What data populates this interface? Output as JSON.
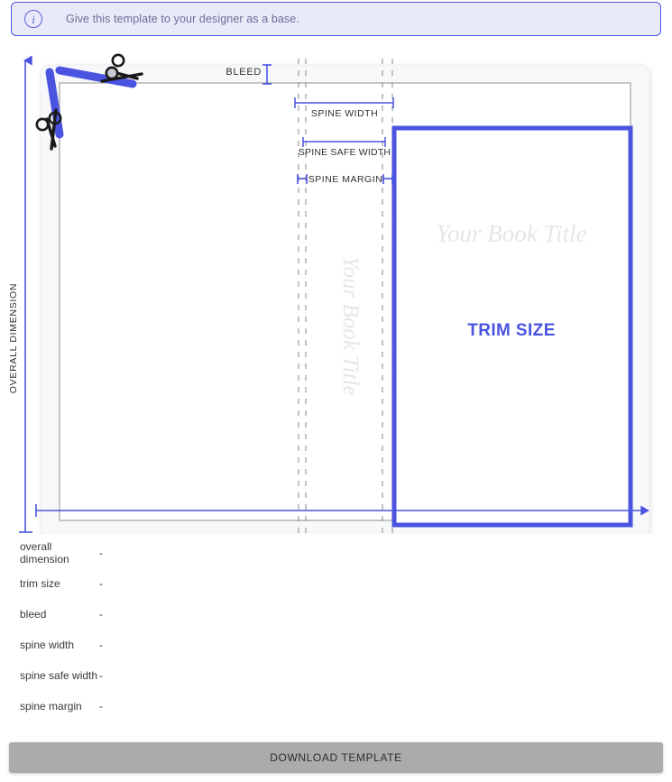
{
  "banner": {
    "icon": "info-circle-icon",
    "message": "Give this template to your designer as a base."
  },
  "diagram": {
    "overall_dimension_label": "OVERALL DIMENSION",
    "bleed_label": "BLEED",
    "spine_width_label": "SPINE WIDTH",
    "spine_safe_width_label": "SPINE SAFE WIDTH",
    "spine_margin_label": "SPINE MARGIN",
    "trim_size_label": "TRIM SIZE",
    "cover_title_placeholder": "Your Book Title",
    "spine_title_placeholder": "Your Book Title",
    "scissors_icon_top": "scissors-icon",
    "scissors_icon_left": "scissors-icon",
    "colors": {
      "accent": "#4a54e1",
      "trim_border": "#4a54e1",
      "guide_dash": "#9a9a9a",
      "placeholder_text": "#e6e6ea",
      "card_bg": "#f7f8fa"
    }
  },
  "specs": [
    {
      "label": "overall dimension",
      "value": "-"
    },
    {
      "label": "trim size",
      "value": "-"
    },
    {
      "label": "bleed",
      "value": "-"
    },
    {
      "label": "spine width",
      "value": "-"
    },
    {
      "label": "spine safe width",
      "value": "-"
    },
    {
      "label": "spine margin",
      "value": "-"
    }
  ],
  "download": {
    "label": "DOWNLOAD TEMPLATE"
  }
}
